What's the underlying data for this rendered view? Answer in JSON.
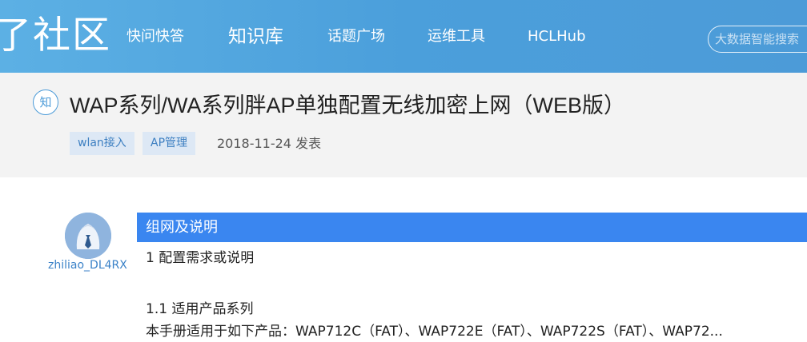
{
  "header": {
    "logo_text": "了社区",
    "nav": [
      {
        "label": "快问快答"
      },
      {
        "label": "知识库",
        "active": true
      },
      {
        "label": "话题广场"
      },
      {
        "label": "运维工具"
      },
      {
        "label": "HCLHub"
      }
    ],
    "search": {
      "placeholder": "大数据智能搜索"
    }
  },
  "article": {
    "badge": "知",
    "title": "WAP系列/WA系列胖AP单独配置无线加密上网（WEB版）",
    "tags": [
      "wlan接入",
      "AP管理"
    ],
    "date": "2018-11-24 发表"
  },
  "content": {
    "author": "zhiliao_DL4RX",
    "section_title": "组网及说明",
    "lines": [
      "1 配置需求或说明",
      "1.1  适用产品系列",
      "本手册适用于如下产品：WAP712C（FAT）、WAP722E（FAT）、WAP722S（FAT）、WAP72..."
    ]
  },
  "colors": {
    "header_bg": "#4c9bd8",
    "section_bar": "#3a86f0",
    "tag_bg": "#dde8f5",
    "tag_text": "#3d7fc1",
    "title_band_bg": "#f3f3f3"
  }
}
